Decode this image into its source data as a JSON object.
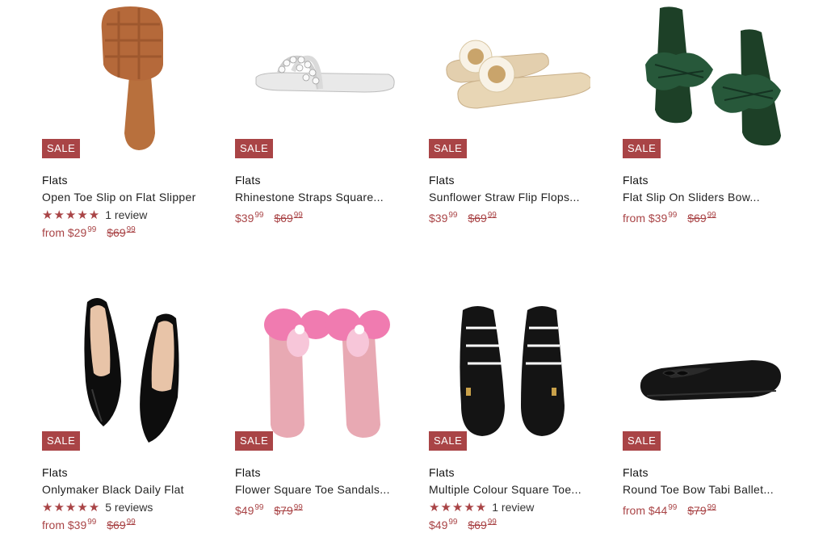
{
  "products": [
    {
      "badge": "SALE",
      "category": "Flats",
      "title": "Open Toe Slip on Flat Slipper",
      "stars": "★★★★★",
      "reviews": "1 review",
      "price_prefix": "from $29",
      "price_cents": "99",
      "old_price_main": "$69",
      "old_price_cents": "99",
      "image_icon": "brown-woven-slide-sandal",
      "colors": {
        "main": "#b5693a"
      }
    },
    {
      "badge": "SALE",
      "category": "Flats",
      "title": "Rhinestone Straps Square...",
      "stars": "",
      "reviews": "",
      "price_prefix": "$39",
      "price_cents": "99",
      "old_price_main": "$69",
      "old_price_cents": "99",
      "image_icon": "silver-rhinestone-slide",
      "colors": {
        "main": "#e6e6e6"
      }
    },
    {
      "badge": "SALE",
      "category": "Flats",
      "title": "Sunflower Straw Flip Flops...",
      "stars": "",
      "reviews": "",
      "price_prefix": "$39",
      "price_cents": "99",
      "old_price_main": "$69",
      "old_price_cents": "99",
      "image_icon": "straw-flip-flop",
      "colors": {
        "main": "#e3cfae"
      }
    },
    {
      "badge": "SALE",
      "category": "Flats",
      "title": "Flat Slip On Sliders Bow...",
      "stars": "",
      "reviews": "",
      "price_prefix": "from $39",
      "price_cents": "99",
      "old_price_main": "$69",
      "old_price_cents": "99",
      "image_icon": "green-bow-slide",
      "colors": {
        "main": "#1f4a2e"
      }
    },
    {
      "badge": "SALE",
      "category": "Flats",
      "title": "Onlymaker Black Daily Flat",
      "stars": "★★★★★",
      "reviews": "5 reviews",
      "price_prefix": "from $39",
      "price_cents": "99",
      "old_price_main": "$69",
      "old_price_cents": "99",
      "image_icon": "black-patent-pointed-flat",
      "colors": {
        "main": "#111111"
      }
    },
    {
      "badge": "SALE",
      "category": "Flats",
      "title": "Flower Square Toe Sandals...",
      "stars": "",
      "reviews": "",
      "price_prefix": "$49",
      "price_cents": "99",
      "old_price_main": "$79",
      "old_price_cents": "99",
      "image_icon": "pink-orchid-slide",
      "colors": {
        "main": "#e8a9b3"
      }
    },
    {
      "badge": "SALE",
      "category": "Flats",
      "title": "Multiple Colour Square Toe...",
      "stars": "★★★★★",
      "reviews": "1 review",
      "price_prefix": "$49",
      "price_cents": "99",
      "old_price_main": "$69",
      "old_price_cents": "99",
      "image_icon": "black-fisherman-sandal",
      "colors": {
        "main": "#141414"
      }
    },
    {
      "badge": "SALE",
      "category": "Flats",
      "title": "Round Toe Bow Tabi Ballet...",
      "stars": "",
      "reviews": "",
      "price_prefix": "from $44",
      "price_cents": "99",
      "old_price_main": "$79",
      "old_price_cents": "99",
      "image_icon": "black-ballet-flat",
      "colors": {
        "main": "#151515"
      }
    }
  ],
  "theme": {
    "accent": "#a94446"
  }
}
